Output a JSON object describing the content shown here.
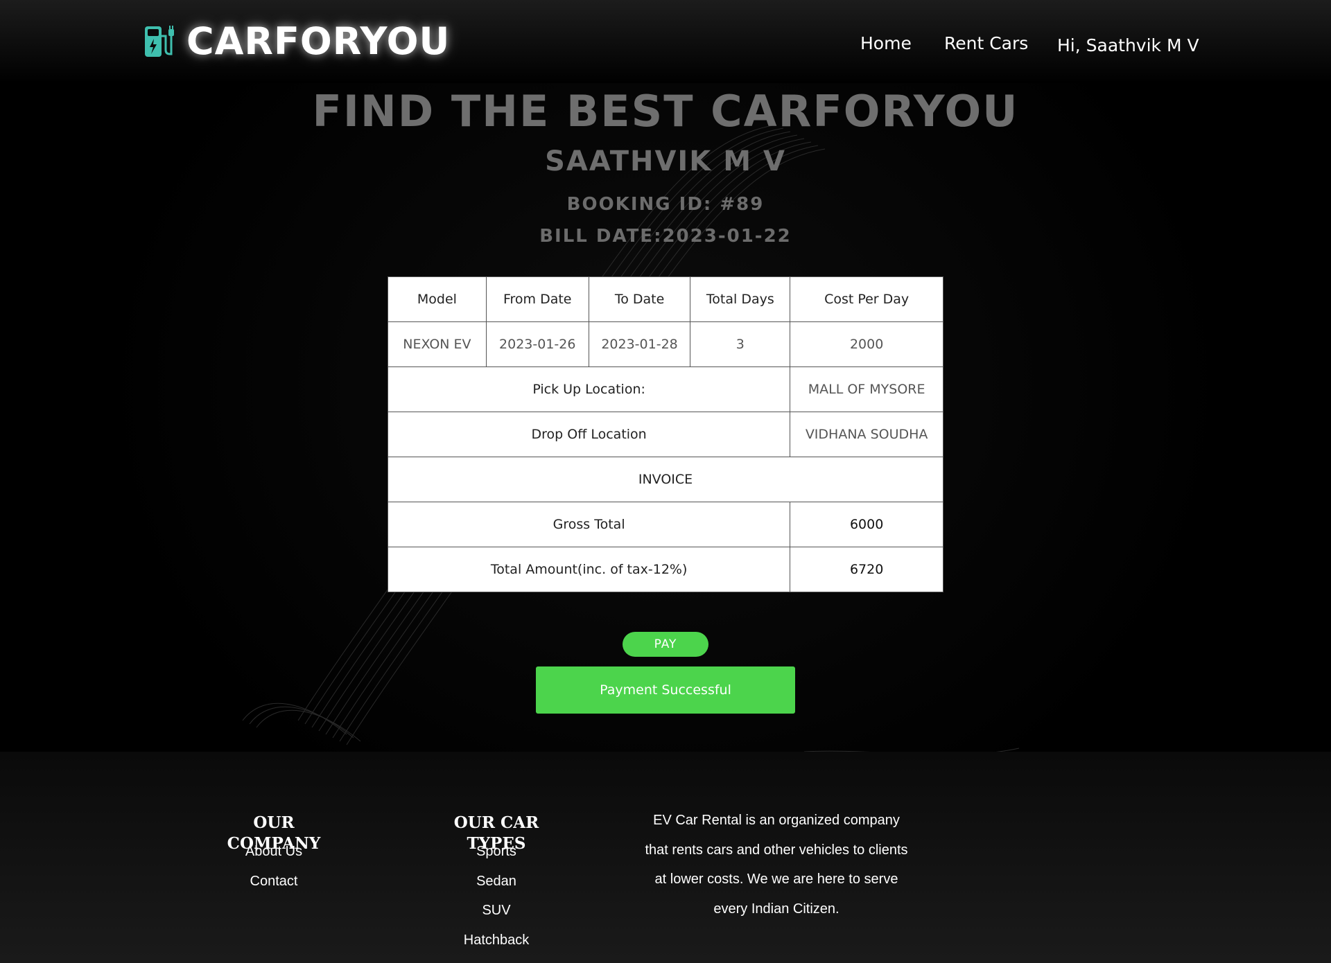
{
  "header": {
    "brand": "CARFORYOU",
    "nav": {
      "home": "Home",
      "rent_cars": "Rent Cars",
      "user_greeting": "Hi, Saathvik M V"
    }
  },
  "hero": {
    "title": "FIND THE BEST CARFORYOU",
    "customer_name": "SAATHVIK M V",
    "booking_id": "BOOKING ID: #89",
    "bill_date": "BILL DATE:2023-01-22"
  },
  "bill_table": {
    "headers": [
      "Model",
      "From Date",
      "To Date",
      "Total Days",
      "Cost Per Day"
    ],
    "row": [
      "NEXON EV",
      "2023-01-26",
      "2023-01-28",
      "3",
      "2000"
    ],
    "pickup_label": "Pick Up Location:",
    "pickup_value": "MALL OF MYSORE",
    "dropoff_label": "Drop Off Location",
    "dropoff_value": "VIDHANA SOUDHA",
    "invoice_label": "INVOICE",
    "gross_label": "Gross Total",
    "gross_value": "6000",
    "total_label": "Total Amount(inc. of tax-12%)",
    "total_value": "6720"
  },
  "payment": {
    "pay_label": "PAY",
    "status_message": "Payment Successful",
    "color": "#4cd44c"
  },
  "footer": {
    "company_heading": "OUR COMPANY",
    "company_links": [
      "About Us",
      "Contact"
    ],
    "car_types_heading": "OUR CAR TYPES",
    "car_types": [
      "Sports",
      "Sedan",
      "SUV",
      "Hatchback"
    ],
    "about_lines": [
      "EV Car Rental is an organized company",
      "that rents cars and other vehicles to clients",
      "at lower costs. We we are here to serve",
      "every Indian Citizen."
    ]
  },
  "theme": {
    "accent": "#4cd44c",
    "logo_teal": "#3fbfae",
    "background": "#000000"
  }
}
